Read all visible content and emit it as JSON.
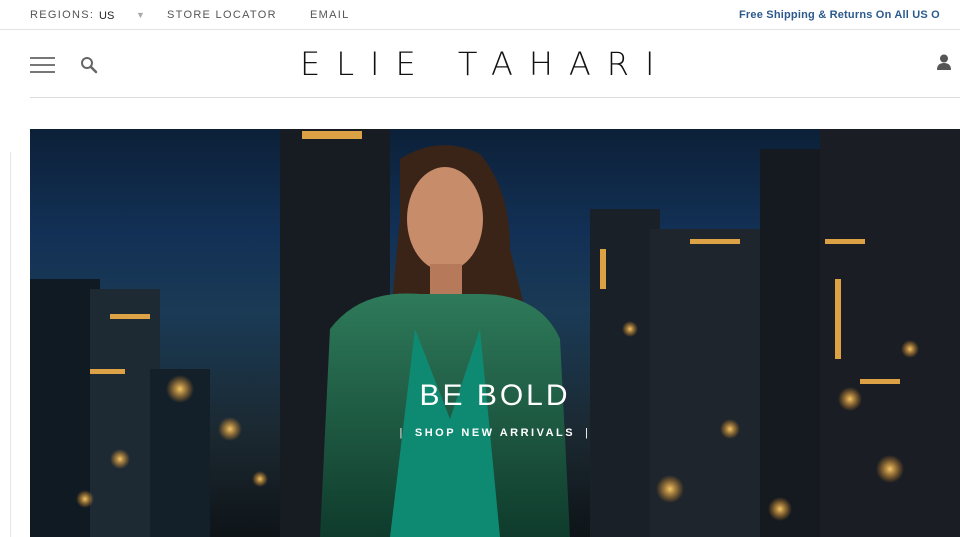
{
  "topbar": {
    "regions_label": "REGIONS:",
    "region_value": "US",
    "store_locator": "STORE LOCATOR",
    "email": "EMAIL",
    "shipping_text": "Free Shipping & Returns On All US O"
  },
  "header": {
    "logo": "ELIE TAHARI"
  },
  "hero": {
    "title": "BE BOLD",
    "cta_prefix": "|",
    "cta": "SHOP NEW ARRIVALS",
    "cta_suffix": "|"
  },
  "icons": {
    "menu": "hamburger-menu-icon",
    "search": "search-icon",
    "account": "user-icon",
    "region_caret": "caret-down-icon"
  },
  "colors": {
    "accent": "#2c5a8c",
    "logo": "#111111"
  }
}
